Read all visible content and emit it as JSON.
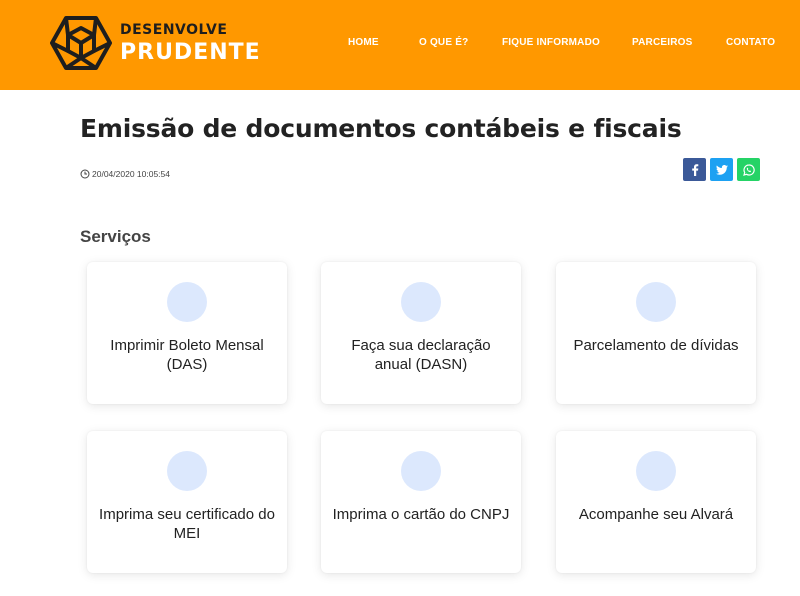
{
  "header": {
    "brand_top": "DESENVOLVE",
    "brand_bottom": "PRUDENTE",
    "nav": [
      {
        "label": "HOME"
      },
      {
        "label": "O QUE É?"
      },
      {
        "label": "FIQUE INFORMADO"
      },
      {
        "label": "PARCEIROS"
      },
      {
        "label": "CONTATO"
      }
    ],
    "colors": {
      "bar": "#ff9800",
      "text": "#ffffff"
    }
  },
  "article": {
    "title": "Emissão de documentos contábeis e fiscais",
    "date": "20/04/2020 10:05:54",
    "share": [
      {
        "icon": "facebook-icon",
        "color": "#3b5998"
      },
      {
        "icon": "twitter-icon",
        "color": "#1da1f2"
      },
      {
        "icon": "whatsapp-icon",
        "color": "#25d366"
      }
    ]
  },
  "services": {
    "heading": "Serviços",
    "items": [
      {
        "label": "Imprimir Boleto Mensal (DAS)"
      },
      {
        "label": "Faça sua declaração anual (DASN)"
      },
      {
        "label": "Parcelamento de dívidas"
      },
      {
        "label": "Imprima seu certificado do MEI"
      },
      {
        "label": "Imprima o cartão do CNPJ"
      },
      {
        "label": "Acompanhe seu Alvará"
      }
    ]
  }
}
